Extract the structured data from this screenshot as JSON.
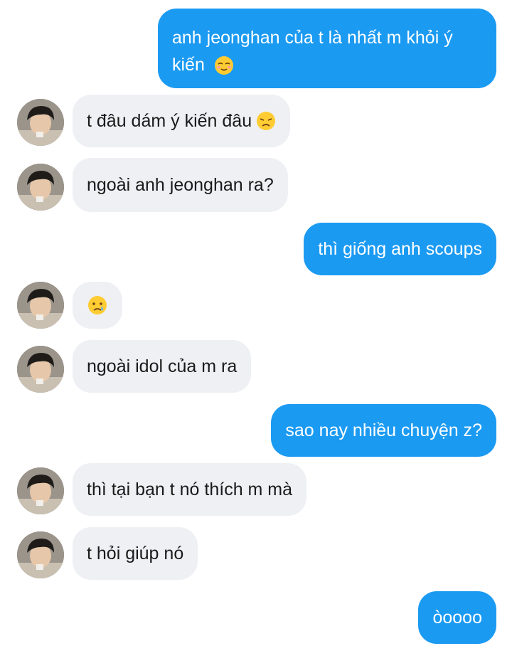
{
  "messages": [
    {
      "side": "out",
      "text": "anh jeonghan của t là nhất m khỏi ý kiến",
      "emoji": "relieved-face-icon"
    },
    {
      "side": "in",
      "text": "t đâu dám ý kiến đâu",
      "emoji": "disappointed-face-icon"
    },
    {
      "side": "in",
      "text": "ngoài anh jeonghan ra?"
    },
    {
      "side": "out",
      "text": "thì giống anh scoups"
    },
    {
      "side": "in",
      "text": "",
      "emoji": "crying-face-icon"
    },
    {
      "side": "in",
      "text": "ngoài idol của m ra"
    },
    {
      "side": "out",
      "text": "sao nay nhiều chuyện z?"
    },
    {
      "side": "in",
      "text": "thì tại bạn t nó thích m mà"
    },
    {
      "side": "in",
      "text": "t hỏi giúp nó"
    },
    {
      "side": "out",
      "text": "òoooo"
    }
  ],
  "colors": {
    "outgoing_bubble": "#1b9af2",
    "incoming_bubble": "#eef0f3"
  }
}
